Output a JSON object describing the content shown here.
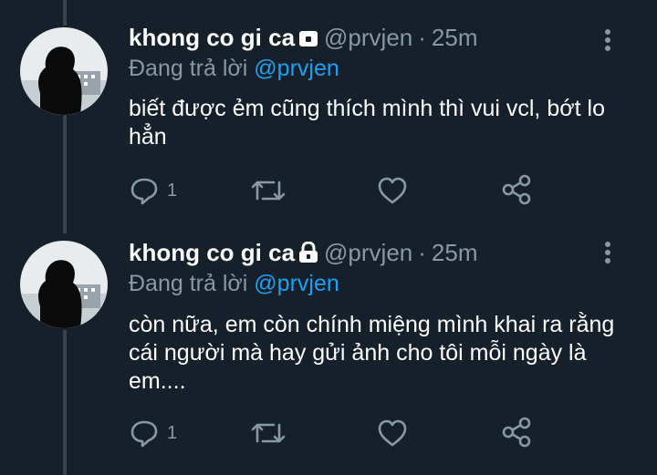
{
  "colors": {
    "background": "#15202b",
    "text_primary": "#ffffff",
    "text_secondary": "#8899a6",
    "accent": "#1da1f2",
    "thread_line": "#38444d"
  },
  "tweets": [
    {
      "display_name": "khong co gi ca",
      "lock_icon": "lock-icon",
      "handle": "@prvjen",
      "separator": "·",
      "time": "25m",
      "replying_prefix": "Đang trả lời",
      "replying_to": "@prvjen",
      "text": "biết được ẻm cũng thích mình thì vui vcl, bớt lo hẳn",
      "reply_count": "1",
      "more_icon": "more-vertical-icon"
    },
    {
      "display_name": "khong co gi ca",
      "lock_icon": "lock-icon",
      "handle": "@prvjen",
      "separator": "·",
      "time": "25m",
      "replying_prefix": "Đang trả lời",
      "replying_to": "@prvjen",
      "text": "còn nữa, em còn chính miệng mình khai ra rằng cái người mà hay gửi ảnh cho tôi mỗi ngày là em....",
      "reply_count": "1",
      "more_icon": "more-vertical-icon"
    }
  ],
  "action_icons": [
    "reply-icon",
    "retweet-icon",
    "like-icon",
    "share-icon"
  ]
}
